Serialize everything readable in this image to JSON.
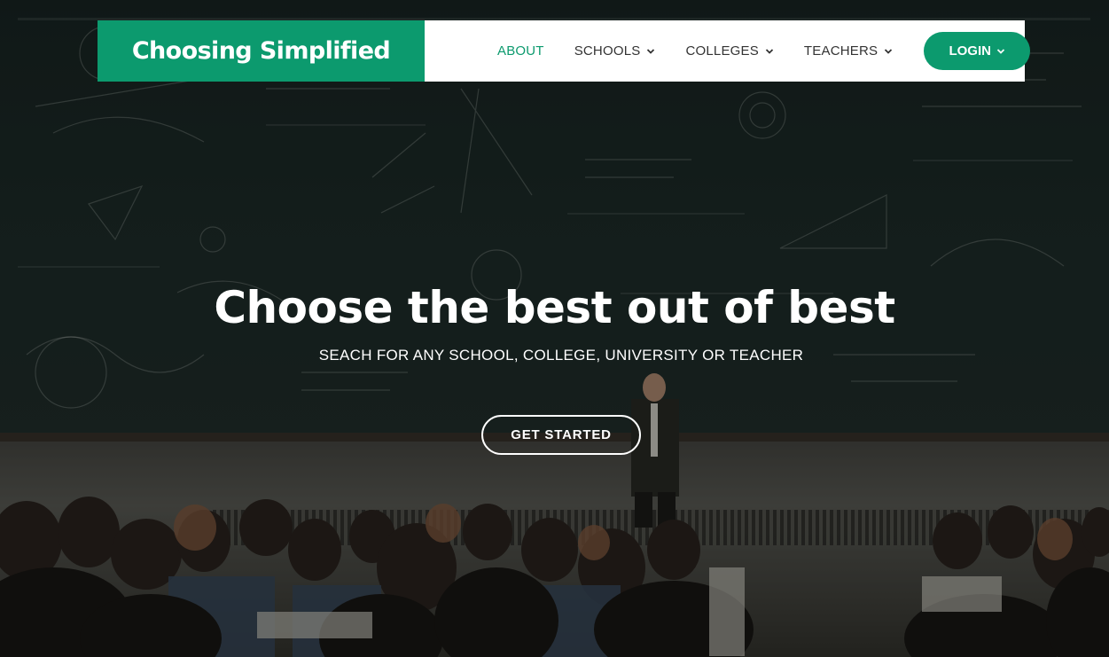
{
  "brand": {
    "name": "Choosing Simplified",
    "color": "#0c9a6e"
  },
  "nav": {
    "items": [
      {
        "label": "ABOUT",
        "active": true,
        "dropdown": false
      },
      {
        "label": "SCHOOLS",
        "active": false,
        "dropdown": true,
        "icon": "chevron-down-icon"
      },
      {
        "label": "COLLEGES",
        "active": false,
        "dropdown": true,
        "icon": "chevron-down-icon"
      },
      {
        "label": "TEACHERS",
        "active": false,
        "dropdown": true,
        "icon": "chevron-down-icon"
      }
    ],
    "login": {
      "label": "LOGIN",
      "icon": "chevron-down-icon"
    }
  },
  "hero": {
    "headline": "Choose the best out of best",
    "subheadline": "SEACH FOR ANY SCHOOL, COLLEGE, UNIVERSITY OR TEACHER",
    "cta_label": "GET STARTED",
    "background": "lecture-hall-chalkboard-photo"
  }
}
